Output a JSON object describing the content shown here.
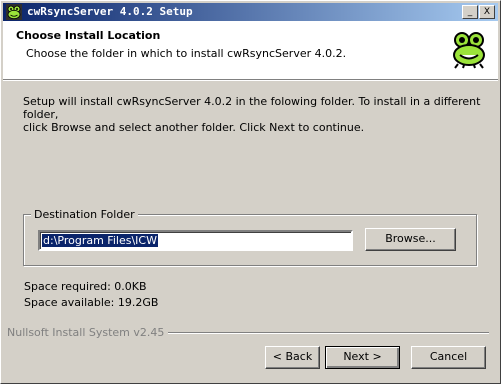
{
  "window": {
    "title": "cwRsyncServer 4.0.2 Setup",
    "minimize_glyph": "_",
    "close_glyph": "X",
    "icon": "frog-app-icon"
  },
  "header": {
    "title": "Choose Install Location",
    "subtitle": "Choose the folder in which to install cwRsyncServer 4.0.2.",
    "logo_icon": "frog-logo-icon"
  },
  "description": {
    "line1": "Setup will install cwRsyncServer 4.0.2 in the folowing folder. To install in a different folder,",
    "line2": "click Browse and select another folder. Click Next to continue."
  },
  "destination": {
    "group_label": "Destination Folder",
    "path": "d:\\Program Files\\ICW",
    "browse_label": "Browse..."
  },
  "space": {
    "required": "Space required: 0.0KB",
    "available": "Space available: 19.2GB"
  },
  "footer": {
    "branding": "Nullsoft Install System v2.45",
    "back_label": "< Back",
    "next_label": "Next >",
    "cancel_label": "Cancel"
  },
  "colors": {
    "titlebar_start": "#0a246a",
    "titlebar_end": "#a6caf0",
    "face": "#d4d0c8",
    "logo_green": "#9be33a"
  }
}
